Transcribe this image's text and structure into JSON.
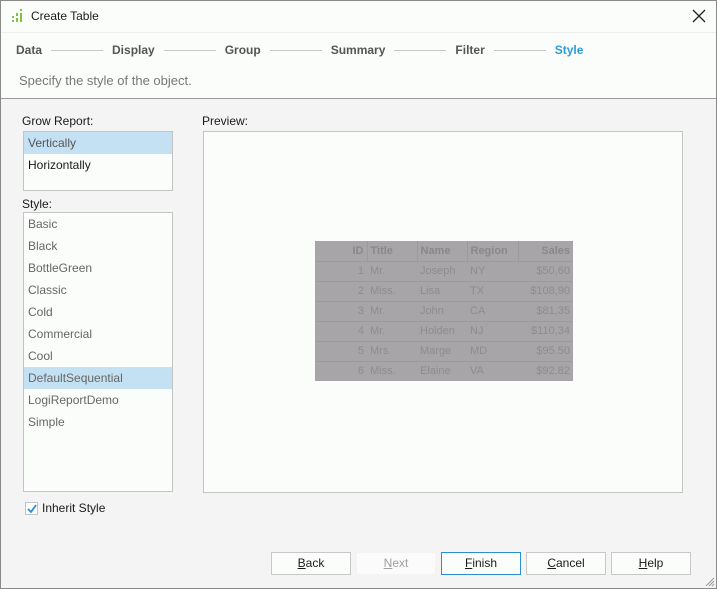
{
  "window": {
    "title": "Create Table",
    "app_icon": "report-bars-icon",
    "close_icon": "close-icon"
  },
  "wizard": {
    "steps": [
      {
        "label": "Data",
        "active": false
      },
      {
        "label": "Display",
        "active": false
      },
      {
        "label": "Group",
        "active": false
      },
      {
        "label": "Summary",
        "active": false
      },
      {
        "label": "Filter",
        "active": false
      },
      {
        "label": "Style",
        "active": true
      }
    ],
    "subtitle": "Specify the style of the object.",
    "accent_color": "#2a9ddc"
  },
  "grow_report": {
    "label": "Grow Report:",
    "options": [
      "Vertically",
      "Horizontally"
    ],
    "selected": "Vertically"
  },
  "style": {
    "label": "Style:",
    "options": [
      "Basic",
      "Black",
      "BottleGreen",
      "Classic",
      "Cold",
      "Commercial",
      "Cool",
      "DefaultSequential",
      "LogiReportDemo",
      "Simple"
    ],
    "selected": "DefaultSequential"
  },
  "preview": {
    "label": "Preview:",
    "columns": [
      "ID",
      "Title",
      "Name",
      "Region",
      "Sales"
    ],
    "rows": [
      [
        "1",
        "Mr.",
        "Joseph",
        "NY",
        "$50,60"
      ],
      [
        "2",
        "Miss.",
        "Lisa",
        "TX",
        "$108,90"
      ],
      [
        "3",
        "Mr.",
        "John",
        "CA",
        "$81,35"
      ],
      [
        "4",
        "Mr.",
        "Holden",
        "NJ",
        "$110,34"
      ],
      [
        "5",
        "Mrs.",
        "Marge",
        "MD",
        "$95.50"
      ],
      [
        "6",
        "Miss.",
        "Elaine",
        "VA",
        "$92.82"
      ]
    ]
  },
  "inherit_style": {
    "label": "Inherit Style",
    "checked": true
  },
  "buttons": {
    "back": {
      "mnemonic": "B",
      "rest": "ack"
    },
    "next": {
      "mnemonic": "N",
      "rest": "ext",
      "disabled": true
    },
    "finish": {
      "mnemonic": "F",
      "rest": "inish"
    },
    "cancel": {
      "mnemonic": "C",
      "rest": "ancel"
    },
    "help": {
      "mnemonic": "H",
      "rest": "elp"
    }
  }
}
